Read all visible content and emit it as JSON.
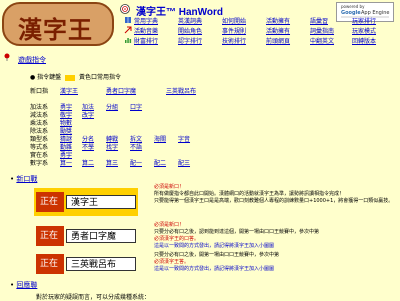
{
  "header": {
    "logo_text": "漢字王",
    "brand": "漢字王™ HanWord",
    "google_badge": {
      "line1": "powered by",
      "google": "Google",
      "suffix": "App Engine"
    }
  },
  "nav": {
    "row1": [
      "常用字典",
      "英漢詞典",
      "如何開始",
      "活動擁有",
      "語彙習",
      "玩家排行"
    ],
    "row2": [
      "活動音樂",
      "開始角色",
      "事件規則",
      "活動擁有",
      "詞彙指南",
      "玩家模式"
    ],
    "row3": [
      "財富排行",
      "認字排行",
      "技術排行",
      "前頭網頁",
      "中翻英文",
      "回轉版本"
    ]
  },
  "section": {
    "title": "遊戲指令",
    "legend_prefix": "指令鍵盤",
    "legend_suffix": "黃色口常用指令",
    "row_labels": [
      "新口指",
      "加法系",
      "減法系",
      "乘法系",
      "除法系",
      "類型系",
      "等式系",
      "實在系",
      "數字系"
    ],
    "row_links": [
      [
        "漢字王",
        "勇者口字魔",
        "三英戰呂布"
      ],
      [
        "勇宇",
        "加法",
        "分組",
        "口字"
      ],
      [
        "敬宇",
        "改字"
      ],
      [
        "物數"
      ],
      [
        "勵獎"
      ],
      [
        "猜謎",
        "分名",
        "轉戰",
        "拆文",
        "海關",
        "字音"
      ],
      [
        "勤雜",
        "不學",
        "找字",
        "不語"
      ],
      [
        "勇宇"
      ],
      [
        "算一",
        "算二",
        "算三",
        "配一",
        "配二",
        "配三"
      ]
    ]
  },
  "bullets": {
    "game": "新口戰",
    "game_help": "回應聯"
  },
  "demos": [
    {
      "tag": "正在",
      "text": "漢字王"
    },
    {
      "tag": "正在",
      "text": "勇者口字魔"
    },
    {
      "tag": "正在",
      "text": "三英戰呂布"
    }
  ],
  "notes": [
    [
      "必須是新口！",
      "所有做慶指令都自此口開始。漢體網口的活動就漢字王為準，讓勢將訊讀相指令完成！",
      "只要能得第一個漢字王口是是高端，歡口刻教難個人專程的訓練數量口+1000+1，將會獲得一口類似贏技。"
    ],
    [
      "必須是新口！",
      "只要分必有口之後，認到能到達這個，開第一場由口口王競賽中，參次中第",
      "必須漢字王的口答。",
      "這是以一致間的方式發出，請記得將漢字王加入小圖圖"
    ],
    [
      "只要分必有口之後，開第一場由口口王競賽中，參次中第",
      "必須漢字王答。",
      "這是以一致間的方式發出，請記得將漢字王加入小圖圖"
    ]
  ],
  "footer": {
    "text": "對於玩家的疑誤而言，可以分成幾種系統："
  }
}
